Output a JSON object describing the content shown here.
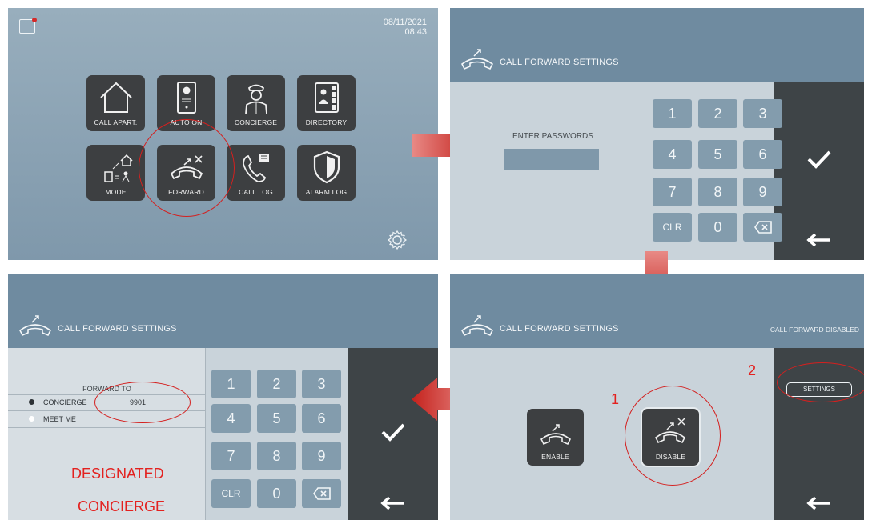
{
  "panel1": {
    "date": "08/11/2021",
    "time": "08:43",
    "tiles": [
      {
        "label": "CALL APART.",
        "icon": "house-icon"
      },
      {
        "label": "AUTO ON",
        "icon": "door-panel-icon"
      },
      {
        "label": "CONCIERGE",
        "icon": "concierge-icon"
      },
      {
        "label": "DIRECTORY",
        "icon": "directory-icon"
      },
      {
        "label": "MODE",
        "icon": "mode-icon"
      },
      {
        "label": "FORWARD",
        "icon": "forward-icon"
      },
      {
        "label": "CALL LOG",
        "icon": "call-log-icon"
      },
      {
        "label": "ALARM LOG",
        "icon": "shield-icon"
      }
    ]
  },
  "panel2": {
    "title": "CALL FORWARD SETTINGS",
    "password_label": "ENTER PASSWORDS",
    "keys": [
      "1",
      "2",
      "3",
      "4",
      "5",
      "6",
      "7",
      "8",
      "9",
      "CLR",
      "0",
      ""
    ]
  },
  "panel3": {
    "title": "CALL FORWARD SETTINGS",
    "status": "CALL FORWARD DISABLED",
    "settings_label": "SETTINGS",
    "enable_label": "ENABLE",
    "disable_label": "DISABLE",
    "step1": "1",
    "step2": "2"
  },
  "panel4": {
    "title": "CALL FORWARD SETTINGS",
    "forward_to_label": "FORWARD TO",
    "option_concierge": "CONCIERGE",
    "option_meet_me": "MEET ME",
    "concierge_number": "9901",
    "keys": [
      "1",
      "2",
      "3",
      "4",
      "5",
      "6",
      "7",
      "8",
      "9",
      "CLR",
      "0",
      ""
    ],
    "annotation_line1": "DESIGNATED",
    "annotation_line2": "CONCIERGE"
  },
  "colors": {
    "annotation_red": "#e3211f",
    "tile_dark": "#3d3f41",
    "header": "#6f8ba0"
  }
}
